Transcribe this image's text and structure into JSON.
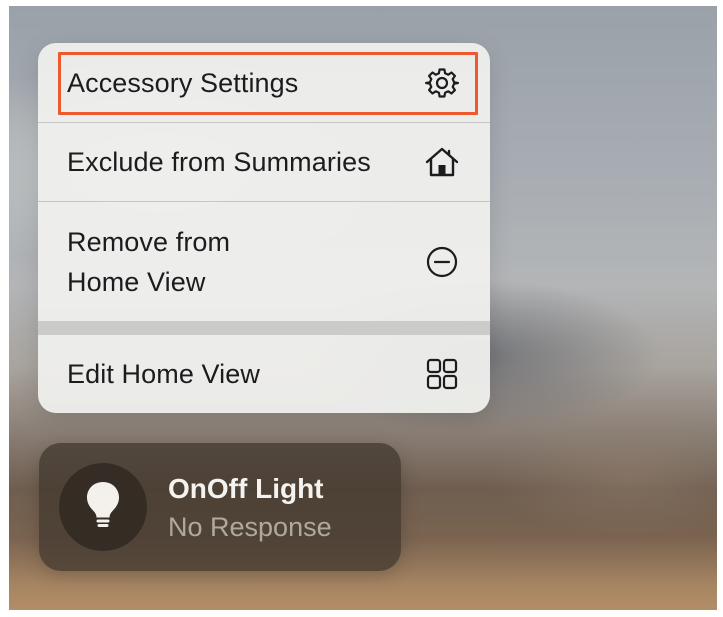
{
  "context_menu": {
    "items": [
      {
        "label": "Accessory Settings",
        "icon": "gear-icon"
      },
      {
        "label": "Exclude from Summaries",
        "icon": "house-icon"
      },
      {
        "label": "Remove from Home View",
        "icon": "minus-circle-icon"
      },
      {
        "label": "Edit Home View",
        "icon": "grid-icon"
      }
    ],
    "highlight_color": "#ee5a2d"
  },
  "accessory_tile": {
    "name": "OnOff Light",
    "status": "No Response",
    "icon": "lightbulb-icon"
  }
}
